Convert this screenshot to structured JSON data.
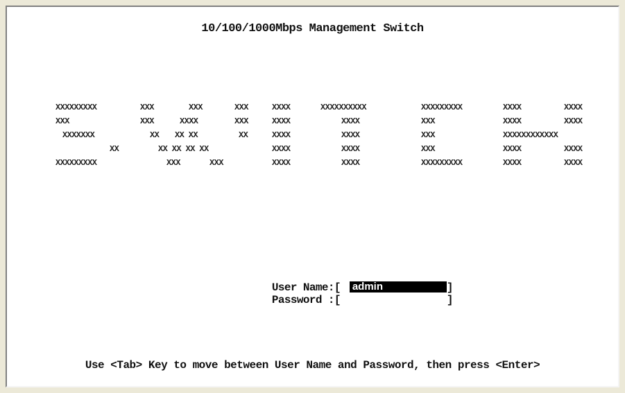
{
  "screen": {
    "title": "10/100/1000Mbps Management Switch",
    "banner_rows": [
      [
        "XXXXXXXXX",
        "XXX",
        "XXX",
        "XXX",
        "XXXX",
        "XXXXXXXXXX",
        "XXXXXXXXX",
        "XXXX",
        "XXXX"
      ],
      [
        "XXX",
        "XXX",
        "XXXX",
        "XXX",
        "XXXX",
        "XXXX",
        "XXX",
        "XXXX",
        "XXXX"
      ],
      [
        "XXXXXXX",
        "XX",
        "XX XX",
        "XX",
        "XXXX",
        "XXXX",
        "XXX",
        "XXXXXXXXXXXX"
      ],
      [
        "XX",
        "XX XX XX XX",
        "XXXX",
        "XXXX",
        "XXX",
        "XXXX",
        "XXXX"
      ],
      [
        "XXXXXXXXX",
        "XXX",
        "XXX",
        "XXXX",
        "XXXX",
        "XXXXXXXXX",
        "XXXX",
        "XXXX"
      ]
    ],
    "login": {
      "username_label": "User Name:[",
      "username_value": "admin",
      "password_label": "Password :[",
      "password_value": "",
      "close_bracket": "]"
    },
    "footer": "Use <Tab> Key to move between User Name and Password, then press <Enter>"
  },
  "colors": {
    "background": "#ffffff",
    "text": "#101010",
    "selection_bg": "#000000",
    "selection_text": "#ffffff"
  }
}
